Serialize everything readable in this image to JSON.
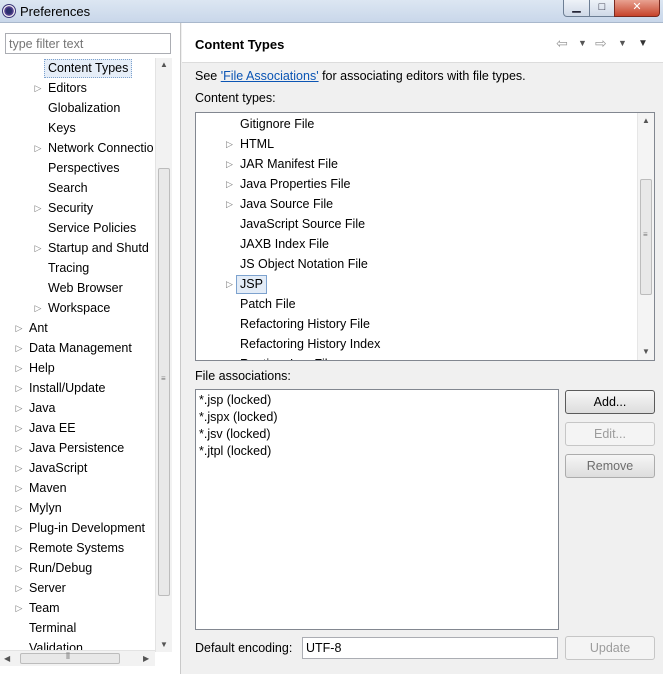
{
  "window": {
    "title": "Preferences"
  },
  "filter": {
    "placeholder": "type filter text"
  },
  "tree": [
    {
      "label": "Content Types",
      "level": 2,
      "expandable": false,
      "selected": true
    },
    {
      "label": "Editors",
      "level": 2,
      "expandable": true
    },
    {
      "label": "Globalization",
      "level": 2,
      "expandable": false
    },
    {
      "label": "Keys",
      "level": 2,
      "expandable": false
    },
    {
      "label": "Network Connectio",
      "level": 2,
      "expandable": true
    },
    {
      "label": "Perspectives",
      "level": 2,
      "expandable": false
    },
    {
      "label": "Search",
      "level": 2,
      "expandable": false
    },
    {
      "label": "Security",
      "level": 2,
      "expandable": true
    },
    {
      "label": "Service Policies",
      "level": 2,
      "expandable": false
    },
    {
      "label": "Startup and Shutd",
      "level": 2,
      "expandable": true
    },
    {
      "label": "Tracing",
      "level": 2,
      "expandable": false
    },
    {
      "label": "Web Browser",
      "level": 2,
      "expandable": false
    },
    {
      "label": "Workspace",
      "level": 2,
      "expandable": true
    },
    {
      "label": "Ant",
      "level": 1,
      "expandable": true
    },
    {
      "label": "Data Management",
      "level": 1,
      "expandable": true
    },
    {
      "label": "Help",
      "level": 1,
      "expandable": true
    },
    {
      "label": "Install/Update",
      "level": 1,
      "expandable": true
    },
    {
      "label": "Java",
      "level": 1,
      "expandable": true
    },
    {
      "label": "Java EE",
      "level": 1,
      "expandable": true
    },
    {
      "label": "Java Persistence",
      "level": 1,
      "expandable": true
    },
    {
      "label": "JavaScript",
      "level": 1,
      "expandable": true
    },
    {
      "label": "Maven",
      "level": 1,
      "expandable": true
    },
    {
      "label": "Mylyn",
      "level": 1,
      "expandable": true
    },
    {
      "label": "Plug-in Development",
      "level": 1,
      "expandable": true
    },
    {
      "label": "Remote Systems",
      "level": 1,
      "expandable": true
    },
    {
      "label": "Run/Debug",
      "level": 1,
      "expandable": true
    },
    {
      "label": "Server",
      "level": 1,
      "expandable": true
    },
    {
      "label": "Team",
      "level": 1,
      "expandable": true
    },
    {
      "label": "Terminal",
      "level": 1,
      "expandable": false
    },
    {
      "label": "Validation",
      "level": 1,
      "expandable": false
    }
  ],
  "page": {
    "title": "Content Types",
    "description_prefix": "See ",
    "description_link": "'File Associations'",
    "description_suffix": " for associating editors with file types.",
    "content_types_label": "Content types:",
    "content_types": [
      {
        "label": "Gitignore File",
        "expandable": false
      },
      {
        "label": "HTML",
        "expandable": true
      },
      {
        "label": "JAR Manifest File",
        "expandable": true
      },
      {
        "label": "Java Properties File",
        "expandable": true
      },
      {
        "label": "Java Source File",
        "expandable": true
      },
      {
        "label": "JavaScript Source File",
        "expandable": false
      },
      {
        "label": "JAXB Index File",
        "expandable": false
      },
      {
        "label": "JS Object Notation File",
        "expandable": false
      },
      {
        "label": "JSP",
        "expandable": true,
        "selected": true
      },
      {
        "label": "Patch File",
        "expandable": false
      },
      {
        "label": "Refactoring History File",
        "expandable": false
      },
      {
        "label": "Refactoring History Index",
        "expandable": false
      },
      {
        "label": "Runtime Log File",
        "expandable": false
      }
    ],
    "file_associations_label": "File associations:",
    "file_associations": [
      "*.jsp (locked)",
      "*.jspx (locked)",
      "*.jsv (locked)",
      "*.jtpl (locked)"
    ],
    "buttons": {
      "add": "Add...",
      "edit": "Edit...",
      "remove": "Remove",
      "update": "Update"
    },
    "default_encoding_label": "Default encoding:",
    "default_encoding_value": "UTF-8"
  }
}
